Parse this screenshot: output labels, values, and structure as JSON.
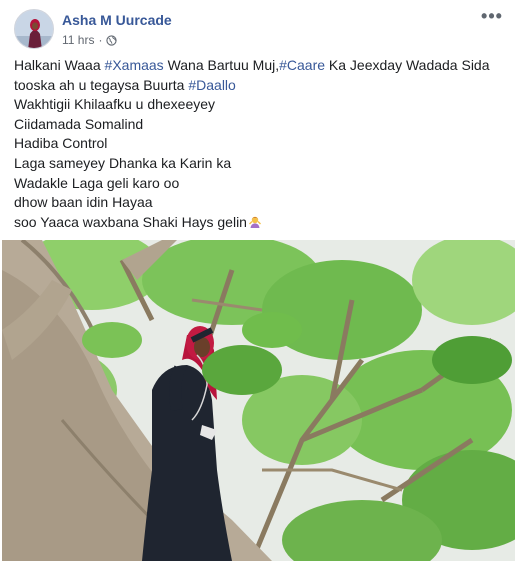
{
  "post": {
    "author": "Asha M Uurcade",
    "time": "11 hrs",
    "separator": "·",
    "privacy_icon": "globe-icon",
    "menu_icon": "more-options-icon",
    "menu_label": "•••",
    "lines": [
      [
        {
          "text": "Halkani Waaa "
        },
        {
          "text": "#Xamaas",
          "hashtag": true
        },
        {
          "text": " Wana Bartuu Muj,"
        },
        {
          "text": "#Caare",
          "hashtag": true
        },
        {
          "text": " Ka Jeexday Wadada Sida"
        }
      ],
      [
        {
          "text": "tooska ah u tegaysa Buurta "
        },
        {
          "text": "#Daallo",
          "hashtag": true
        }
      ],
      [
        {
          "text": "Wakhtigii Khilaafku u dhexeeyey"
        }
      ],
      [
        {
          "text": "Ciidamada Somalind"
        }
      ],
      [
        {
          "text": "Hadiba Control"
        }
      ],
      [
        {
          "text": "Laga sameyey Dhanka ka Karin ka"
        }
      ],
      [
        {
          "text": "Wadakle Laga geli karo oo"
        }
      ],
      [
        {
          "text": "dhow baan idin Hayaa"
        }
      ],
      [
        {
          "text": "soo Yaaca waxbana Shaki Hays gelin"
        },
        {
          "emoji": "woman-gesturing-icon"
        }
      ]
    ],
    "colors": {
      "author": "#385898",
      "hashtag": "#385898",
      "text": "#1c1e21",
      "meta": "#616770"
    }
  }
}
